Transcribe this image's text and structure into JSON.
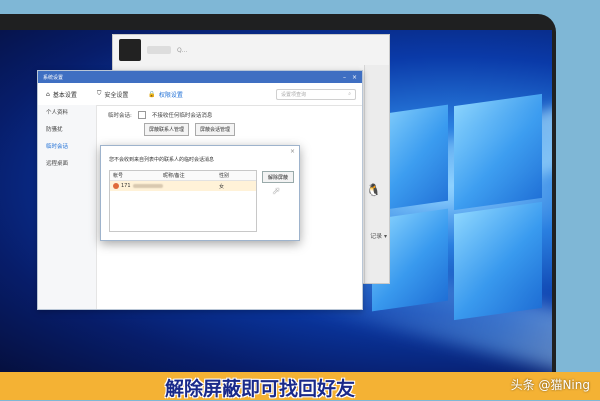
{
  "background_window": {
    "title_text": "Q..."
  },
  "settings_window": {
    "title": "系统设置",
    "tabs": [
      {
        "label": "基本设置",
        "icon": "home-icon"
      },
      {
        "label": "安全设置",
        "icon": "shield-icon"
      },
      {
        "label": "权限设置",
        "icon": "lock-icon"
      }
    ],
    "search_placeholder": "设置项查询",
    "sidebar": [
      "个人资料",
      "防骚扰",
      "临时会话",
      "远程桌面"
    ],
    "content": {
      "label": "临时会话:",
      "checkbox_label": "不接收任何临时会话消息",
      "button_blocked": "屏蔽联系人管理",
      "button_session": "屏蔽会话管理"
    }
  },
  "dialog": {
    "title": "您不会收到来自列表中的联系人的临时会话消息",
    "columns": [
      "帐号",
      "昵称/备注",
      "性别"
    ],
    "row": {
      "account": "171",
      "gender": "女"
    },
    "unblock_button": "解除屏蔽"
  },
  "right_side": {
    "label": "记录 ▾"
  },
  "caption": "解除屏蔽即可找回好友",
  "watermark": "头条 @猫Ning"
}
